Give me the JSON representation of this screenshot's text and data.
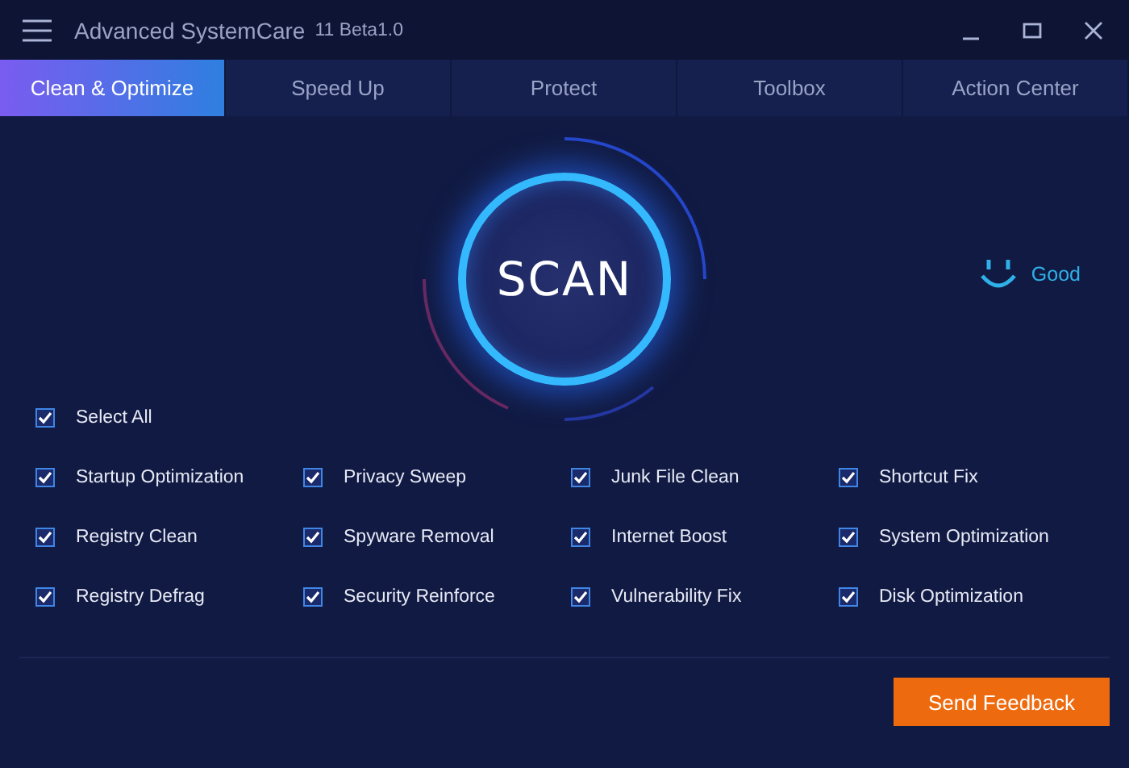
{
  "window": {
    "title": "Advanced SystemCare",
    "version": "11 Beta1.0"
  },
  "tabs": [
    {
      "label": "Clean & Optimize",
      "selected": true
    },
    {
      "label": "Speed Up",
      "selected": false
    },
    {
      "label": "Protect",
      "selected": false
    },
    {
      "label": "Toolbox",
      "selected": false
    },
    {
      "label": "Action Center",
      "selected": false
    }
  ],
  "scan": {
    "label": "SCAN"
  },
  "status": {
    "label": "Good"
  },
  "select_all": {
    "label": "Select All",
    "checked": true
  },
  "options": [
    {
      "label": "Startup Optimization",
      "checked": true
    },
    {
      "label": "Privacy Sweep",
      "checked": true
    },
    {
      "label": "Junk File Clean",
      "checked": true
    },
    {
      "label": "Shortcut Fix",
      "checked": true
    },
    {
      "label": "Registry Clean",
      "checked": true
    },
    {
      "label": "Spyware Removal",
      "checked": true
    },
    {
      "label": "Internet Boost",
      "checked": true
    },
    {
      "label": "System Optimization",
      "checked": true
    },
    {
      "label": "Registry Defrag",
      "checked": true
    },
    {
      "label": "Security Reinforce",
      "checked": true
    },
    {
      "label": "Vulnerability Fix",
      "checked": true
    },
    {
      "label": "Disk Optimization",
      "checked": true
    }
  ],
  "buttons": [
    {
      "label": "Send Feedback"
    }
  ]
}
